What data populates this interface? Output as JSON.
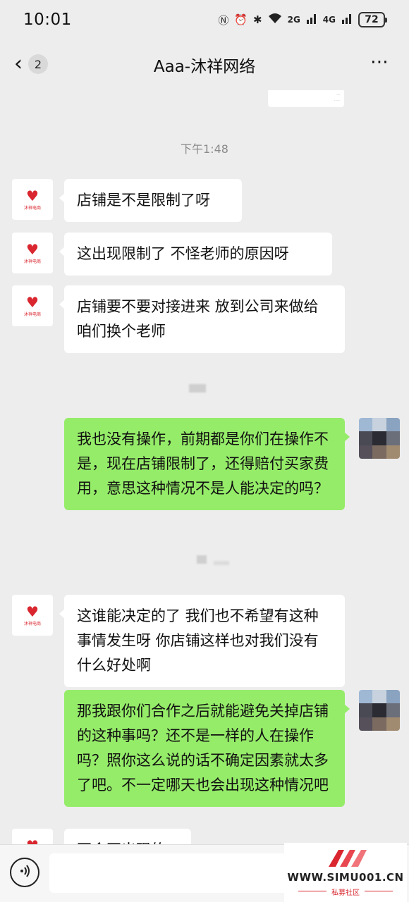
{
  "status_bar": {
    "time": "10:01",
    "signal_2g": "2G",
    "signal_4g": "4G",
    "battery": "72"
  },
  "header": {
    "back_badge": "2",
    "title": "Aaa-沐祥网络"
  },
  "avatar_brand": "沐祥电商",
  "messages": {
    "timestamp": "下午1:48",
    "m1": "店铺是不是限制了呀",
    "m2": "这出现限制了 不怪老师的原因呀",
    "m3": "店铺要不要对接进来 放到公司来做给咱们换个老师",
    "m4": "我也没有操作，前期都是你们在操作不是，现在店铺限制了，还得赔付买家费用，意思这种情况不是人能决定的吗？",
    "m5": "这谁能决定的了 我们也不希望有这种事情发生呀 你店铺这样也对我们没有什么好处啊",
    "m6": "那我跟你们合作之后就能避免关掉店铺的这种事吗？还不是一样的人在操作吗？照你这么说的话不确定因素就太多了吧。不一定哪天也会出现这种情况吧",
    "m7": "不会再出现的"
  },
  "watermark": {
    "site": "WWW.SIMU001.CN",
    "label": "私募社区"
  },
  "colors": {
    "background": "#ededed",
    "bubble_mine": "#95ec69",
    "bubble_other": "#ffffff",
    "brand_red": "#d9262f"
  }
}
